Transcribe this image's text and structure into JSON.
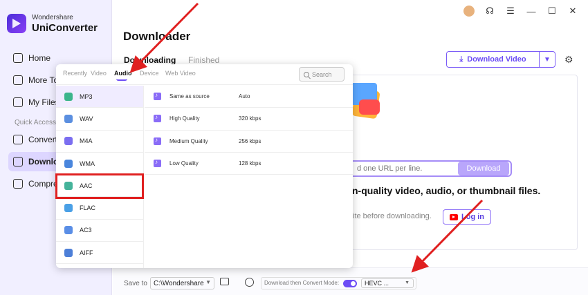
{
  "app": {
    "brand_small": "Wondershare",
    "brand_big": "UniConverter"
  },
  "sidebar": {
    "items": [
      {
        "label": "Home",
        "icon": "home-icon"
      },
      {
        "label": "More To",
        "icon": "grid-icon"
      },
      {
        "label": "My Files",
        "icon": "files-icon"
      },
      {
        "label": "Converte",
        "icon": "convert-icon"
      },
      {
        "label": "Downlo",
        "icon": "download-icon",
        "active": true
      },
      {
        "label": "Compre",
        "icon": "compress-icon"
      }
    ],
    "quick_access": "Quick Access"
  },
  "page": {
    "title": "Downloader",
    "tabs": [
      {
        "label": "Downloading",
        "active": true
      },
      {
        "label": "Finished"
      }
    ],
    "download_video": "Download Video",
    "url_placeholder": "d one URL per line.",
    "url_button": "Download",
    "headline": "n-quality video, audio, or thumbnail files.",
    "hint": "ite before downloading.",
    "login": "Log in"
  },
  "popup": {
    "tabs": [
      "Recently",
      "Video",
      "Audio",
      "Device",
      "Web Video"
    ],
    "active_tab": "Audio",
    "search_placeholder": "Search",
    "formats": [
      "MP3",
      "WAV",
      "M4A",
      "WMA",
      "AAC",
      "FLAC",
      "AC3",
      "AIFF"
    ],
    "selected_format": "MP3",
    "highlighted_format": "AAC",
    "qualities": [
      {
        "name": "Same as source",
        "rate": "Auto"
      },
      {
        "name": "High Quality",
        "rate": "320 kbps"
      },
      {
        "name": "Medium Quality",
        "rate": "256 kbps"
      },
      {
        "name": "Low Quality",
        "rate": "128 kbps"
      }
    ]
  },
  "bottom": {
    "save_to_label": "Save to",
    "save_path": "C:\\Wondershare",
    "mode_label": "Download then Convert Mode:",
    "codec": "HEVC ..."
  },
  "colors": {
    "accent": "#6c4cf5",
    "annotation": "#e02020"
  }
}
